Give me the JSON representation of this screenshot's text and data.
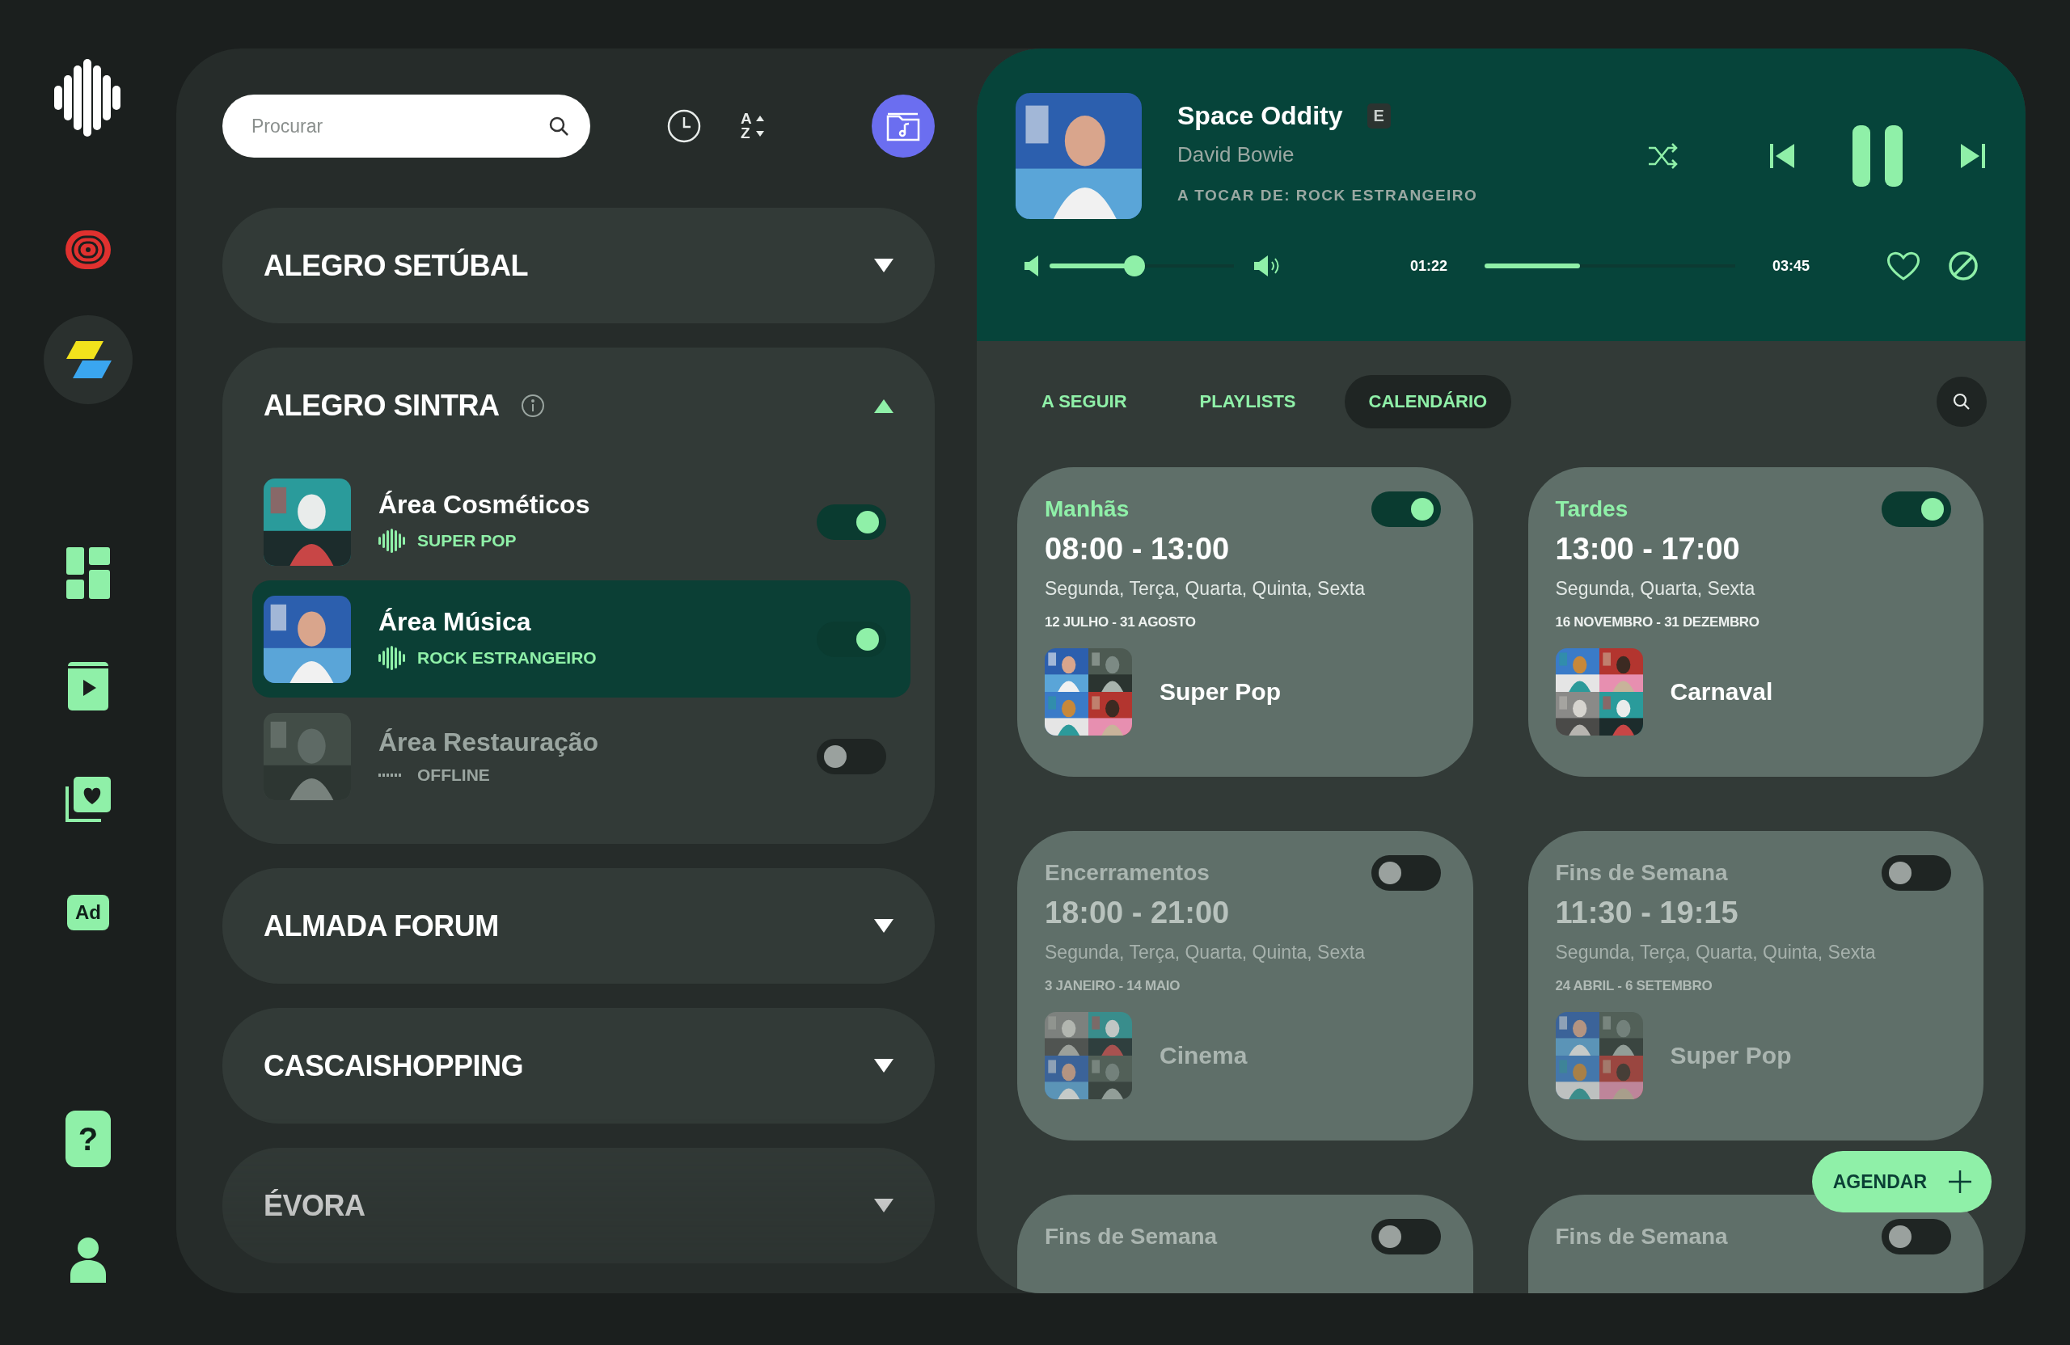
{
  "rail": [
    {
      "kind": "logo"
    },
    {
      "kind": "spiral",
      "selected": false
    },
    {
      "kind": "tiles",
      "selected": true
    },
    {
      "kind": "grid",
      "selected": false
    },
    {
      "kind": "play",
      "selected": false
    },
    {
      "kind": "heart",
      "selected": false
    },
    {
      "kind": "ad",
      "label": "Ad",
      "selected": false
    },
    {
      "kind": "help",
      "label": "?",
      "selected": false
    },
    {
      "kind": "user",
      "selected": false
    }
  ],
  "search": {
    "placeholder": "Procurar"
  },
  "sort": {
    "letters": [
      "A",
      "Z"
    ]
  },
  "groups": [
    {
      "name": "ALEGRO SETÚBAL",
      "expanded": false
    },
    {
      "name": "ALEGRO SINTRA",
      "expanded": true,
      "info": true,
      "areas": [
        {
          "name": "Área Cosméticos",
          "playlist": "SUPER POP",
          "on": true,
          "selected": false
        },
        {
          "name": "Área Música",
          "playlist": "ROCK ESTRANGEIRO",
          "on": true,
          "selected": true
        },
        {
          "name": "Área Restauração",
          "playlist": "OFFLINE",
          "on": false,
          "selected": false
        }
      ]
    },
    {
      "name": "ALMADA FORUM",
      "expanded": false
    },
    {
      "name": "CASCAISHOPPING",
      "expanded": false
    },
    {
      "name": "ÉVORA",
      "expanded": false
    }
  ],
  "player": {
    "title": "Space Oddity",
    "explicit": "E",
    "artist": "David Bowie",
    "source": "A TOCAR DE: ROCK ESTRANGEIRO",
    "playing": true,
    "volume": {
      "level": 0.46
    },
    "elapsed": "01:22",
    "progress": {
      "level": 0.38
    },
    "duration": "03:45",
    "liked": false
  },
  "tabs": [
    {
      "label": "A SEGUIR",
      "selected": false
    },
    {
      "label": "PLAYLISTS",
      "selected": false
    },
    {
      "label": "CALENDÁRIO",
      "selected": true
    }
  ],
  "schedules": [
    {
      "title": "Manhãs",
      "on": true,
      "time": "08:00 - 13:00",
      "days": "Segunda, Terça, Quarta, Quinta, Sexta",
      "dates": "12 JULHO -  31 AGOSTO",
      "playlist": "Super Pop"
    },
    {
      "title": "Tardes",
      "on": true,
      "time": "13:00 - 17:00",
      "days": "Segunda, Quarta, Sexta",
      "dates": "16 NOVEMBRO -  31 DEZEMBRO",
      "playlist": "Carnaval"
    },
    {
      "title": "Encerramentos",
      "on": false,
      "time": "18:00 - 21:00",
      "days": "Segunda, Terça, Quarta, Quinta, Sexta",
      "dates": "3 JANEIRO -  14 MAIO",
      "playlist": "Cinema"
    },
    {
      "title": "Fins de Semana",
      "on": false,
      "time": "11:30 - 19:15",
      "days": "Segunda, Terça, Quarta, Quinta, Sexta",
      "dates": "24 ABRIL -  6 SETEMBRO",
      "playlist": "Super Pop"
    },
    {
      "title": "Fins de Semana",
      "on": false
    },
    {
      "title": "Fins de Semana",
      "on": false
    }
  ],
  "schedule_button": {
    "label": "AGENDAR"
  }
}
